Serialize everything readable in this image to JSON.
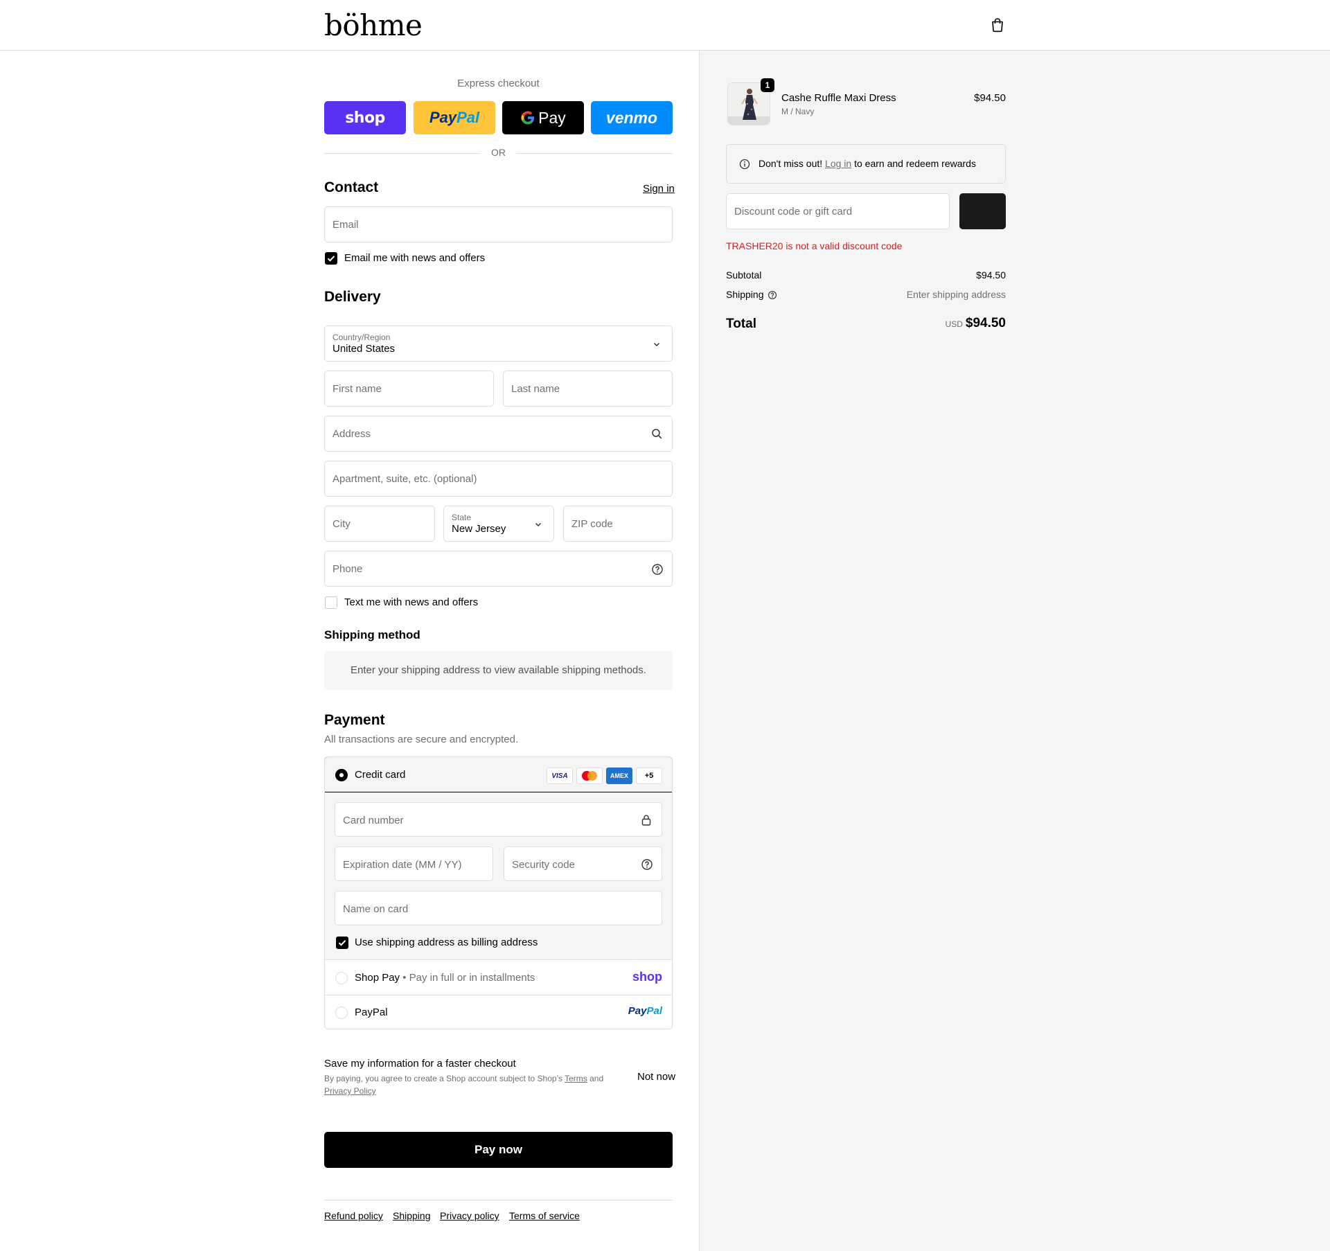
{
  "header": {
    "logo": "böhme"
  },
  "express": {
    "label": "Express checkout",
    "shop": "shop",
    "paypal_pay": "Pay",
    "paypal_pal": "Pal",
    "gpay": "Pay",
    "venmo": "venmo",
    "or": "OR"
  },
  "contact": {
    "title": "Contact",
    "sign_in": "Sign in",
    "email_placeholder": "Email",
    "newsletter_label": "Email me with news and offers",
    "newsletter_checked": true
  },
  "delivery": {
    "title": "Delivery",
    "country_label": "Country/Region",
    "country_value": "United States",
    "first_name": "First name",
    "last_name": "Last name",
    "address": "Address",
    "apartment": "Apartment, suite, etc. (optional)",
    "city": "City",
    "state_label": "State",
    "state_value": "New Jersey",
    "zip": "ZIP code",
    "phone": "Phone",
    "sms_label": "Text me with news and offers",
    "sms_checked": false
  },
  "shipping_method": {
    "title": "Shipping method",
    "message": "Enter your shipping address to view available shipping methods."
  },
  "payment": {
    "title": "Payment",
    "subtitle": "All transactions are secure and encrypted.",
    "credit_card_label": "Credit card",
    "card_brands": [
      "VISA",
      "mastercard",
      "AMEX"
    ],
    "more_brands": "+5",
    "card_number": "Card number",
    "expiration": "Expiration date (MM / YY)",
    "security_code": "Security code",
    "name_on_card": "Name on card",
    "billing_same_label": "Use shipping address as billing address",
    "billing_same_checked": true,
    "shop_pay_label": "Shop Pay",
    "shop_pay_sub": "Pay in full or in installments",
    "shop_pay_logo": "shop",
    "paypal_label": "PayPal",
    "paypal_logo_pay": "Pay",
    "paypal_logo_pal": "Pal"
  },
  "save_info": {
    "title": "Save my information for a faster checkout",
    "terms_prefix": "By paying, you agree to create a Shop account subject to Shop’s ",
    "terms_link": "Terms",
    "terms_and": " and",
    "privacy_link": "Privacy Policy",
    "not_now": "Not now"
  },
  "pay_now": "Pay now",
  "footer": {
    "links": [
      "Refund policy",
      "Shipping",
      "Privacy policy",
      "Terms of service"
    ]
  },
  "summary": {
    "item_name": "Cashe Ruffle Maxi Dress",
    "item_variant": "M / Navy",
    "item_price": "$94.50",
    "item_qty": "1",
    "rewards_prefix": "Don't miss out! ",
    "rewards_link": "Log in",
    "rewards_suffix": " to earn and redeem rewards",
    "discount_placeholder": "Discount code or gift card",
    "discount_error": "TRASHER20 is not a valid discount code",
    "subtotal_label": "Subtotal",
    "subtotal_value": "$94.50",
    "shipping_label": "Shipping",
    "shipping_value": "Enter shipping address",
    "total_label": "Total",
    "currency": "USD",
    "total_value": "$94.50"
  },
  "colors": {
    "shop_purple": "#5a31f4",
    "paypal_yellow": "#ffc439",
    "venmo_blue": "#008cff",
    "error_red": "#dd1d1d",
    "summary_bg": "#f5f5f5"
  }
}
